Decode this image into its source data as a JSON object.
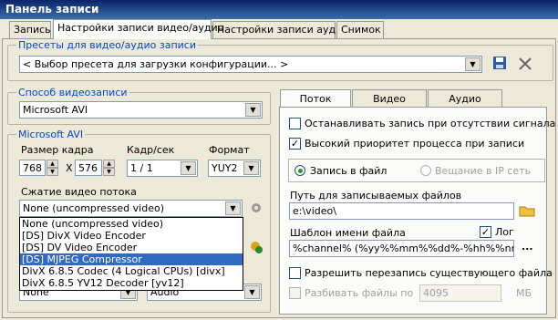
{
  "window": {
    "title": "Панель записи"
  },
  "tabs": [
    "Запись",
    "Настройки записи видео/аудио",
    "Настройки записи аудио",
    "Снимок"
  ],
  "presets": {
    "label": "Пресеты для видео/аудио записи",
    "value": "< Выбор пресета для загрузки конфигурации... >"
  },
  "method": {
    "label": "Способ видеозаписи",
    "value": "Microsoft AVI"
  },
  "avi": {
    "label": "Microsoft AVI",
    "frame_size_label": "Размер кадра",
    "width": "768",
    "x_sep": "X",
    "height": "576",
    "fps_label": "Кадр/сек",
    "fps_value": "1 / 1",
    "format_label": "Формат",
    "format_value": "YUY2",
    "compression_label": "Сжатие видео потока",
    "compression_value": "None (uncompressed video)",
    "compression_options": [
      "None (uncompressed video)",
      "[DS] DivX Video Encoder",
      "[DS] DV Video Encoder",
      "[DS] MJPEG Compressor",
      "DivX 6.8.5 Codec (4 Logical CPUs) [divx]",
      "DivX 6.8.5 YV12 Decoder [yv12]"
    ],
    "selected_option": "[DS] MJPEG Compressor",
    "bottom_left_value": "None",
    "bottom_right_value": "Audio"
  },
  "right_tabs": [
    "Поток",
    "Видео",
    "Аудио"
  ],
  "stream": {
    "stop_no_signal": "Останавливать запись при отсутствии сигнала",
    "high_priority": "Высокий приоритет процесса при записи",
    "record_to_file": "Запись в файл",
    "broadcast_ip": "Вещание в IP сеть",
    "path_label": "Путь для записываемых файлов",
    "path_value": "e:\\video\\",
    "template_label": "Шаблон имени файла",
    "log_label": "Лог",
    "template_value": "%channel% (%yy%%mm%%dd%-%hh%%nn%",
    "more_button": "...",
    "overwrite": "Разрешить перезапись существующего файла",
    "split_label": "Разбивать файлы по",
    "split_value": "4095",
    "split_unit": "МБ"
  }
}
